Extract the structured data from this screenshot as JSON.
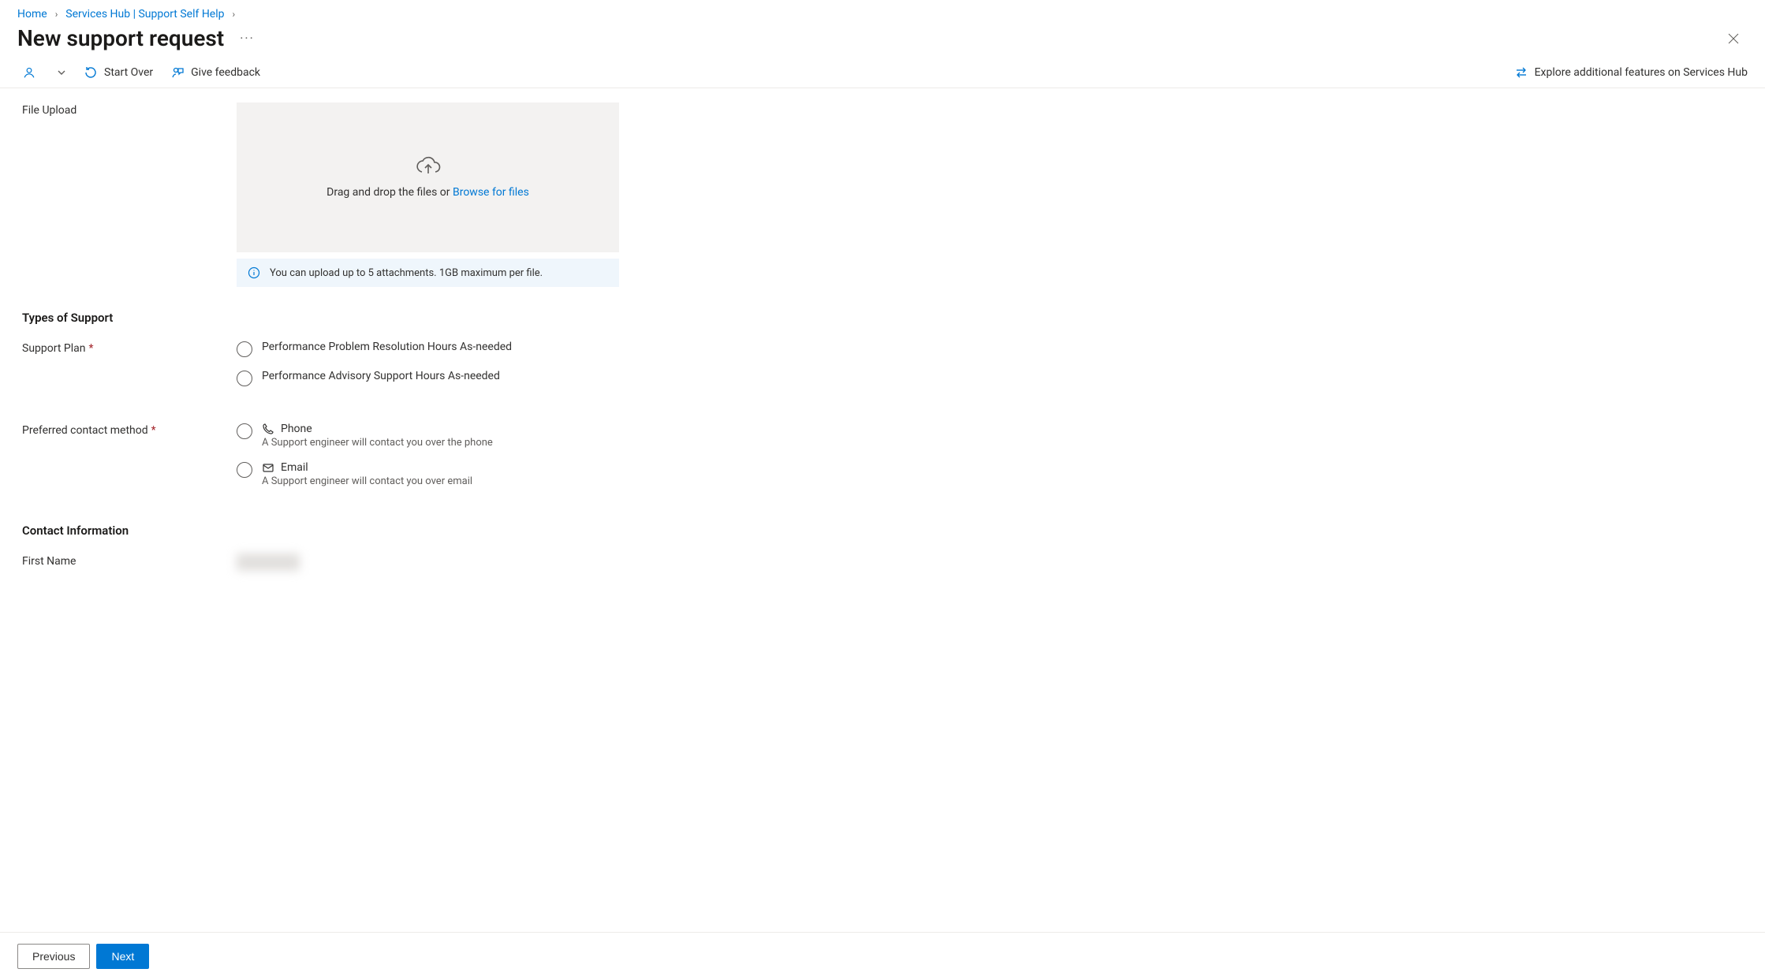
{
  "breadcrumb": {
    "home": "Home",
    "services_hub": "Services Hub | Support Self Help"
  },
  "page_title": "New support request",
  "toolbar": {
    "start_over": "Start Over",
    "give_feedback": "Give feedback",
    "explore": "Explore additional features on Services Hub"
  },
  "file_upload": {
    "label": "File Upload",
    "drop_prefix": "Drag and drop the files or ",
    "browse_link": "Browse for files",
    "info_text": "You can upload up to 5 attachments. 1GB maximum per file."
  },
  "types_of_support": {
    "section_title": "Types of Support",
    "support_plan_label": "Support Plan",
    "options": [
      "Performance Problem Resolution Hours As-needed",
      "Performance Advisory Support Hours As-needed"
    ],
    "contact_method_label": "Preferred contact method",
    "contact_options": {
      "phone_title": "Phone",
      "phone_sub": "A Support engineer will contact you over the phone",
      "email_title": "Email",
      "email_sub": "A Support engineer will contact you over email"
    }
  },
  "contact_info": {
    "section_title": "Contact Information",
    "first_name_label": "First Name"
  },
  "footer": {
    "previous": "Previous",
    "next": "Next"
  }
}
